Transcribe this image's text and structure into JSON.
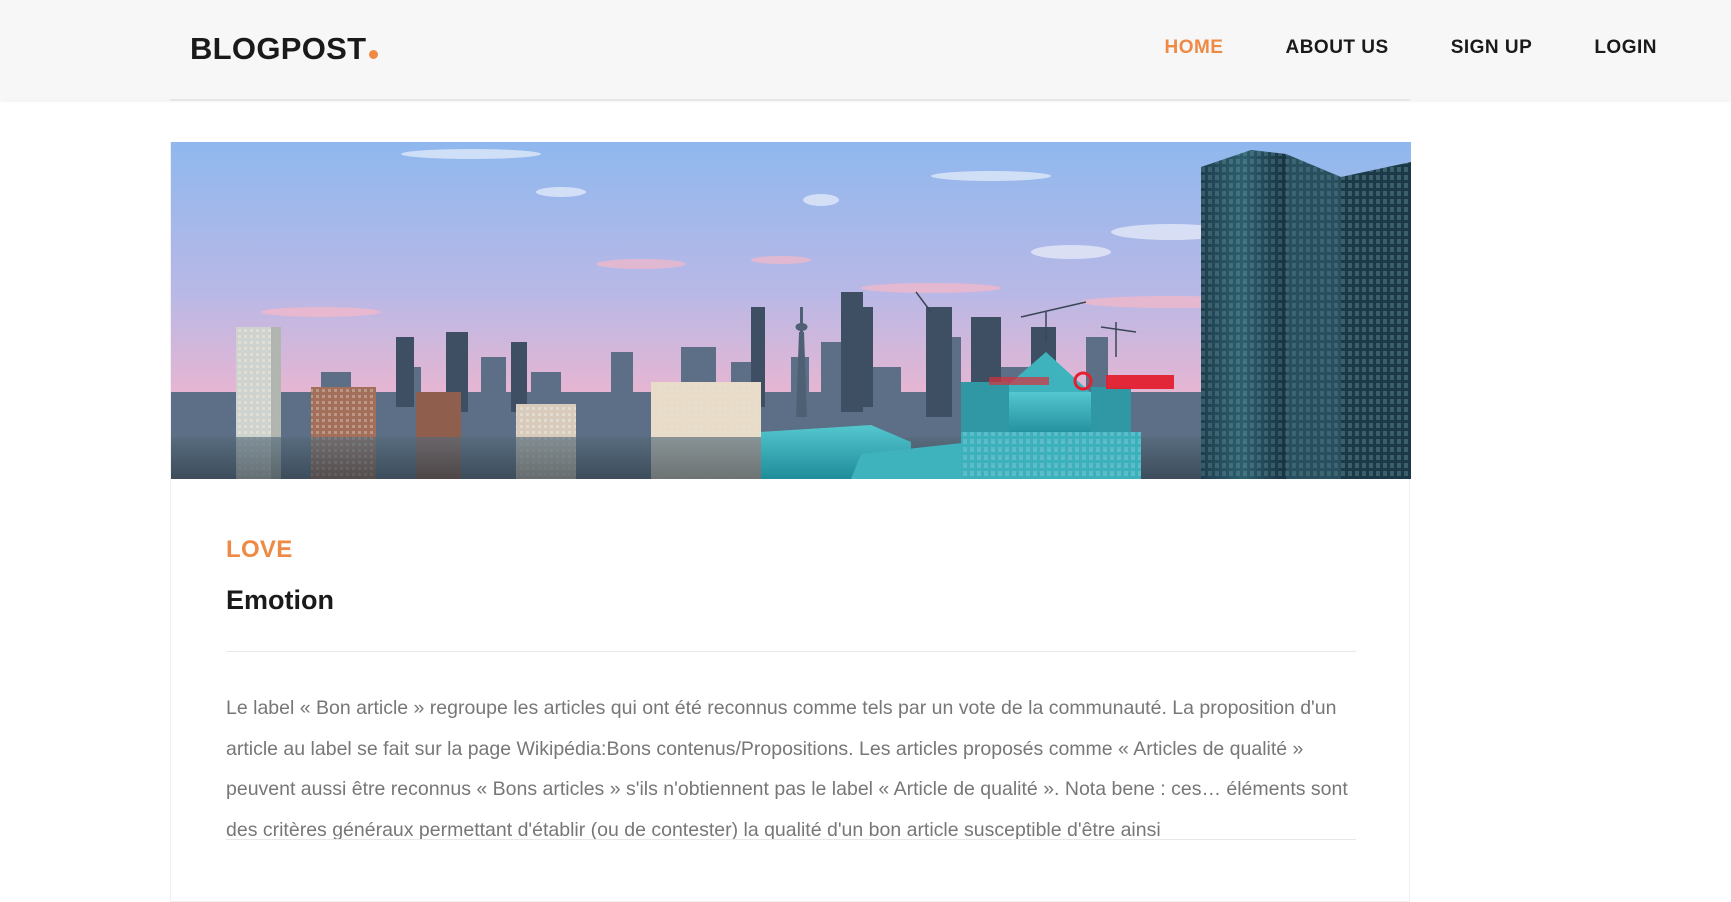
{
  "header": {
    "logo_text": "BLOGPOST",
    "accent_color": "#ef8a45",
    "nav": [
      {
        "label": "HOME",
        "active": true
      },
      {
        "label": "ABOUT US",
        "active": false
      },
      {
        "label": "SIGN UP",
        "active": false
      },
      {
        "label": "LOGIN",
        "active": false
      }
    ]
  },
  "post": {
    "image_description": "city-skyline-photo",
    "category": "LOVE",
    "title": "Emotion",
    "excerpt": "Le label « Bon article » regroupe les articles qui ont été reconnus comme tels par un vote de la communauté. La proposition d'un article au label se fait sur la page Wikipédia:Bons contenus/Propositions. Les articles proposés comme « Articles de qualité » peuvent aussi être reconnus « Bons articles » s'ils n'obtiennent pas le label « Article de qualité ». Nota bene : ces… éléments sont des critères généraux permettant d'établir (ou de contester) la qualité d'un bon article susceptible d'être ainsi"
  }
}
